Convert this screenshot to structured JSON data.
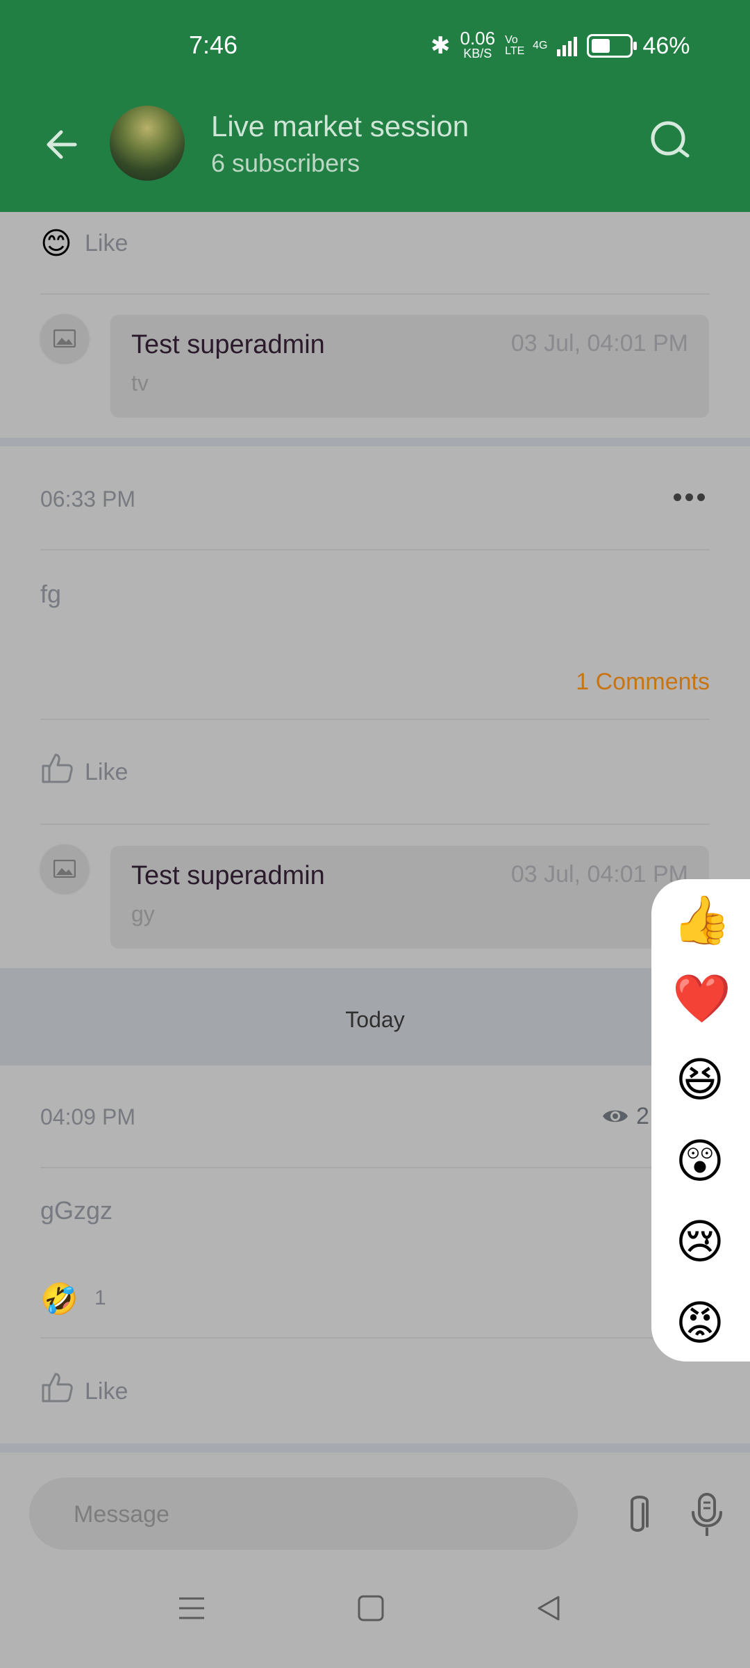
{
  "status_bar": {
    "time": "7:46",
    "net_speed": "0.06",
    "net_unit": "KB/S",
    "volte": "Vo LTE",
    "network": "4G",
    "battery_pct": "46%"
  },
  "header": {
    "title": "Live market session",
    "subtitle": "6  subscribers"
  },
  "post_top": {
    "reaction_label": "Like",
    "reaction_emoji": "😊",
    "comment": {
      "author": "Test superadmin",
      "date": "03 Jul, 04:01 PM",
      "text": "tv"
    }
  },
  "post_fg": {
    "time": "06:33 PM",
    "text": "fg",
    "comments_link": "1  Comments",
    "like_label": "Like",
    "comment": {
      "author": "Test superadmin",
      "date": "03 Jul, 04:01 PM",
      "text": "gy"
    }
  },
  "today_label": "Today",
  "post_today": {
    "time": "04:09 PM",
    "views": "2",
    "text": "gGzgz",
    "reaction_emoji": "🤣",
    "reaction_count": "1",
    "like_label": "Like"
  },
  "reactions": [
    "👍",
    "❤️",
    "😆",
    "😲",
    "😢",
    "😡"
  ],
  "message_bar": {
    "placeholder": "Message"
  },
  "colors": {
    "header": "#217f44",
    "accent_orange": "#c97412"
  }
}
